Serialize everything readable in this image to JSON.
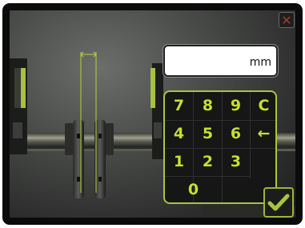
{
  "window": {
    "close_icon": "close-x-icon"
  },
  "measurement_field": {
    "value": "",
    "unit": "mm"
  },
  "keypad": {
    "keys": [
      "7",
      "8",
      "9",
      "C",
      "4",
      "5",
      "6",
      "←",
      "1",
      "2",
      "3",
      "0"
    ]
  },
  "confirm": {
    "icon": "checkmark-icon"
  },
  "colors": {
    "accent": "#a9c53a",
    "key_text": "#c6df33",
    "close": "#a33a2c"
  }
}
